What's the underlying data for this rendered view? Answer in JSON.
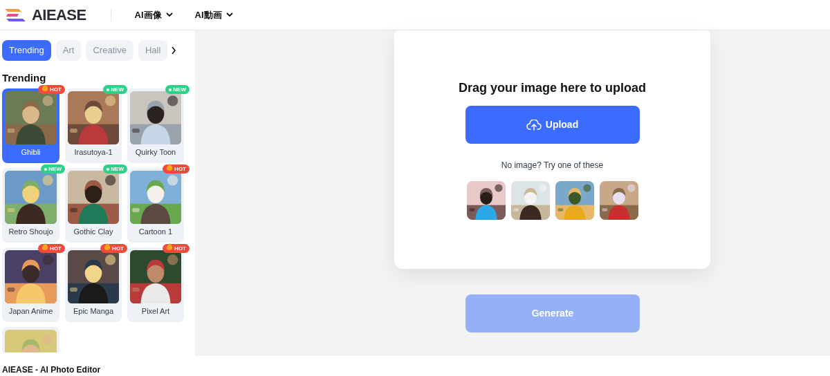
{
  "header": {
    "brand": "AIEASE",
    "nav": [
      {
        "label": "AI画像"
      },
      {
        "label": "AI動画"
      }
    ]
  },
  "sidebar": {
    "tabs": [
      {
        "label": "Trending",
        "selected": true
      },
      {
        "label": "Art",
        "selected": false
      },
      {
        "label": "Creative",
        "selected": false
      },
      {
        "label": "Hall",
        "selected": false
      }
    ],
    "section_title": "Trending",
    "styles": [
      {
        "label": "Ghibli",
        "badge": "HOT",
        "selected": true,
        "kind": "picture"
      },
      {
        "label": "Irasutoya-1",
        "badge": "NEW",
        "selected": false,
        "kind": "picture"
      },
      {
        "label": "Quirky Toon",
        "badge": "NEW",
        "selected": false,
        "kind": "picture"
      },
      {
        "label": "Retro Shoujo",
        "badge": "NEW",
        "selected": false,
        "kind": "picture"
      },
      {
        "label": "Gothic Clay",
        "badge": "NEW",
        "selected": false,
        "kind": "picture"
      },
      {
        "label": "Cartoon 1",
        "badge": "HOT",
        "selected": false,
        "kind": "picture"
      },
      {
        "label": "Japan Anime",
        "badge": "HOT",
        "selected": false,
        "kind": "picture"
      },
      {
        "label": "Epic Manga",
        "badge": "HOT",
        "selected": false,
        "kind": "picture"
      },
      {
        "label": "Pixel Art",
        "badge": "HOT",
        "selected": false,
        "kind": "picture"
      },
      {
        "selected": false,
        "kind": "picture"
      }
    ],
    "footer_title": "AIEASE - AI Photo Editor"
  },
  "upload_card": {
    "title": "Drag your image here to upload",
    "upload_button": "Upload",
    "hint": "No image? Try one of these",
    "samples": [
      {
        "kind": "picture"
      },
      {
        "kind": "picture"
      },
      {
        "kind": "picture"
      },
      {
        "kind": "picture"
      }
    ]
  },
  "generate_button": {
    "label": "Generate",
    "disabled": true
  }
}
